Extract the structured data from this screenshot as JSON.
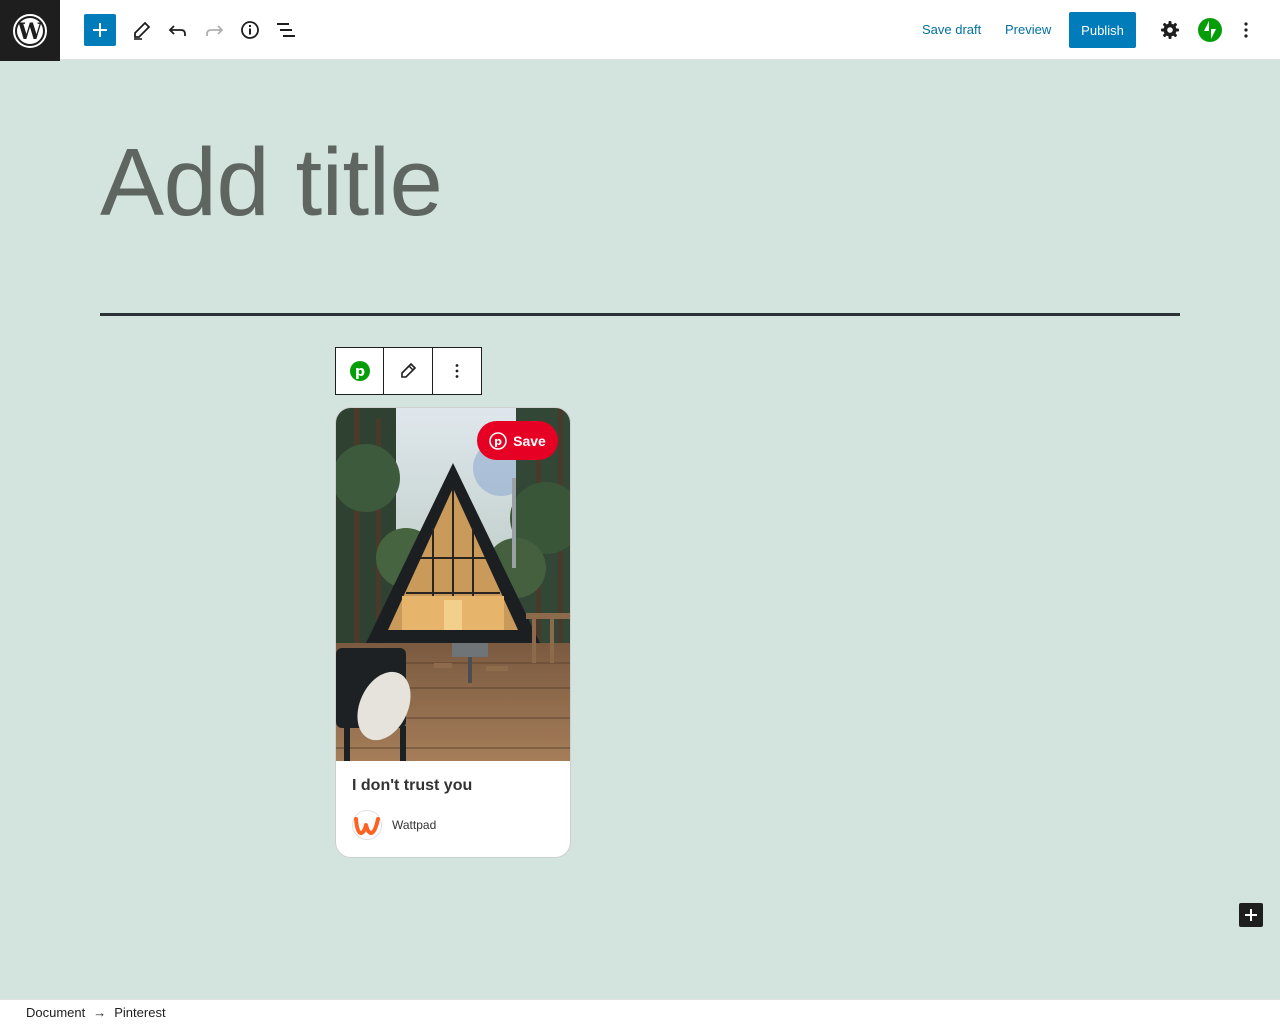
{
  "toolbar": {
    "save_draft": "Save draft",
    "preview": "Preview",
    "publish": "Publish",
    "icons": [
      "wordpress-logo-icon",
      "plus-icon",
      "pencil-icon",
      "undo-icon",
      "redo-icon",
      "info-icon",
      "list-view-icon",
      "gear-icon",
      "jetpack-icon",
      "more-vertical-icon"
    ]
  },
  "editor": {
    "title_placeholder": "Add title"
  },
  "block_toolbar": {
    "icons": [
      "pinterest-icon",
      "edit-icon",
      "more-vertical-icon"
    ]
  },
  "pin": {
    "save_label": "Save",
    "title": "I don't trust you",
    "author": "Wattpad"
  },
  "breadcrumb": {
    "items": [
      "Document",
      "Pinterest"
    ],
    "separator": "→"
  },
  "colors": {
    "accent": "#007cba",
    "canvas_bg": "#d3e4de",
    "pinterest_red": "#e60023",
    "jetpack_green": "#069e08",
    "wattpad_orange": "#ff6122"
  }
}
